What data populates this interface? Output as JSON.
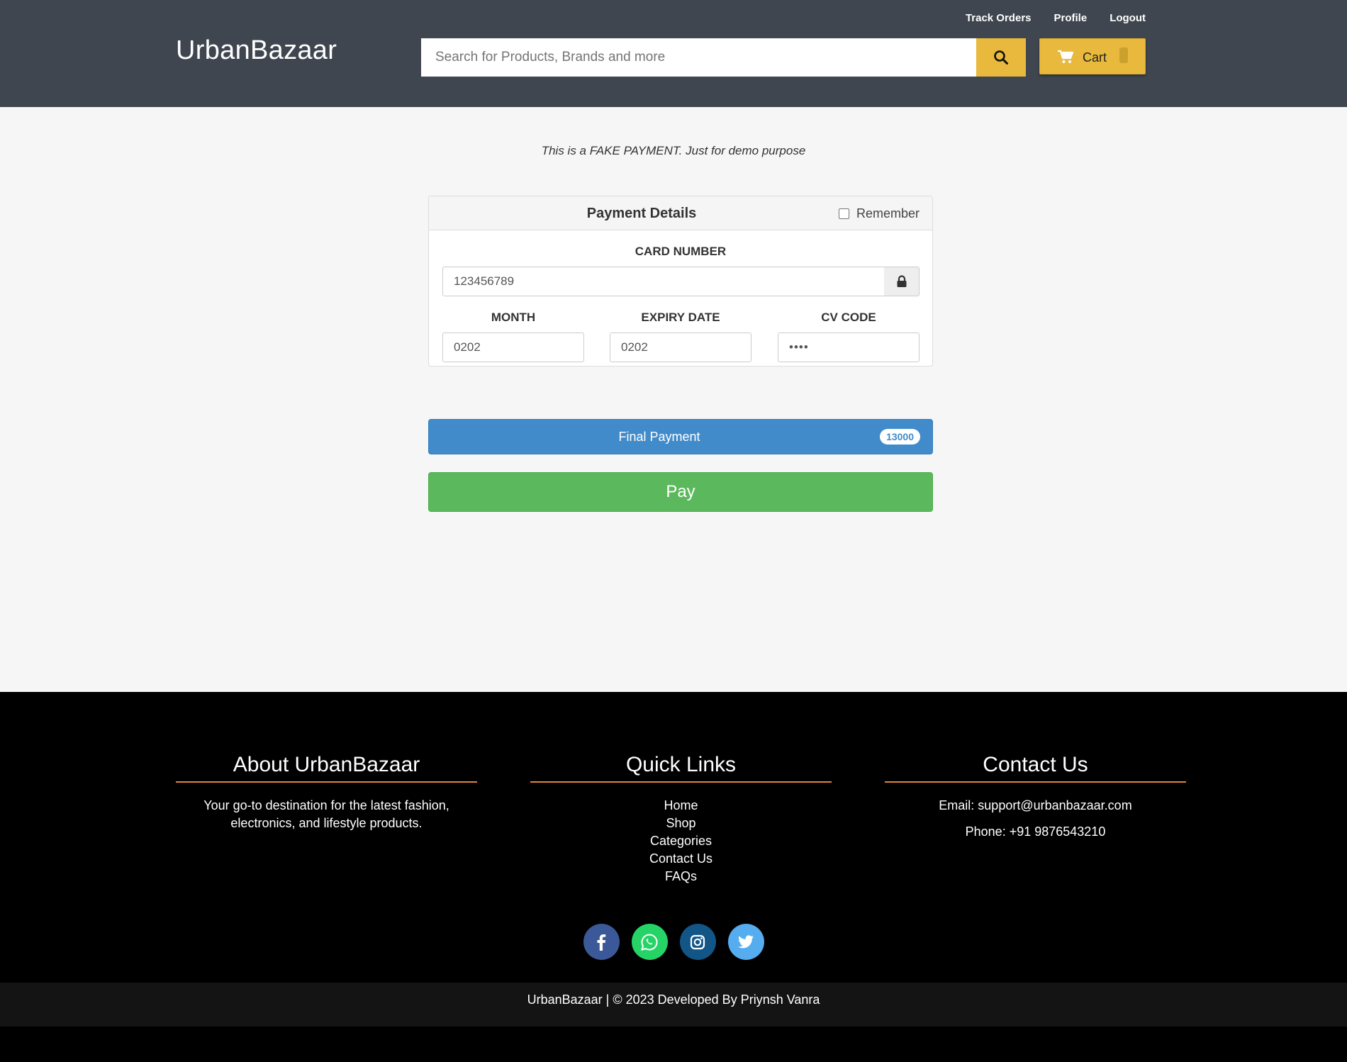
{
  "header": {
    "brand": "UrbanBazaar",
    "links": {
      "track_orders": "Track Orders",
      "profile": "Profile",
      "logout": "Logout"
    },
    "search": {
      "placeholder": "Search for Products, Brands and more",
      "icon": "search-icon"
    },
    "cart": {
      "label": "Cart",
      "icon": "cart-icon"
    }
  },
  "main": {
    "notice": "This is a FAKE PAYMENT. Just for demo purpose",
    "panel": {
      "title": "Payment Details",
      "remember_label": "Remember",
      "remember_checked": false,
      "card_number_label": "CARD NUMBER",
      "card_number_value": "123456789",
      "month_label": "MONTH",
      "month_value": "0202",
      "expiry_label": "EXPIRY DATE",
      "expiry_value": "0202",
      "cv_label": "CV CODE",
      "cv_value": "••••"
    },
    "final_payment": {
      "label": "Final Payment",
      "amount": "13000"
    },
    "pay_button": "Pay"
  },
  "footer": {
    "about": {
      "title": "About UrbanBazaar",
      "text_line1": "Your go-to destination for the latest fashion,",
      "text_line2": "electronics, and lifestyle products."
    },
    "quick_links": {
      "title": "Quick Links",
      "items": [
        "Home",
        "Shop",
        "Categories",
        "Contact Us",
        "FAQs"
      ]
    },
    "contact": {
      "title": "Contact Us",
      "email": "Email: support@urbanbazaar.com",
      "phone": "Phone: +91 9876543210"
    },
    "socials": [
      {
        "name": "facebook",
        "color": "#3b5998"
      },
      {
        "name": "whatsapp",
        "color": "#25d366"
      },
      {
        "name": "instagram",
        "color": "#125688"
      },
      {
        "name": "twitter",
        "color": "#55acee"
      }
    ],
    "copyright": "UrbanBazaar | © 2023 Developed By Priynsh Vanra"
  },
  "colors": {
    "header_bg": "#3f4650",
    "accent_yellow": "#e8b93c",
    "primary_blue": "#428bca",
    "success_green": "#5cb85c",
    "footer_underline": "#e0853a"
  }
}
